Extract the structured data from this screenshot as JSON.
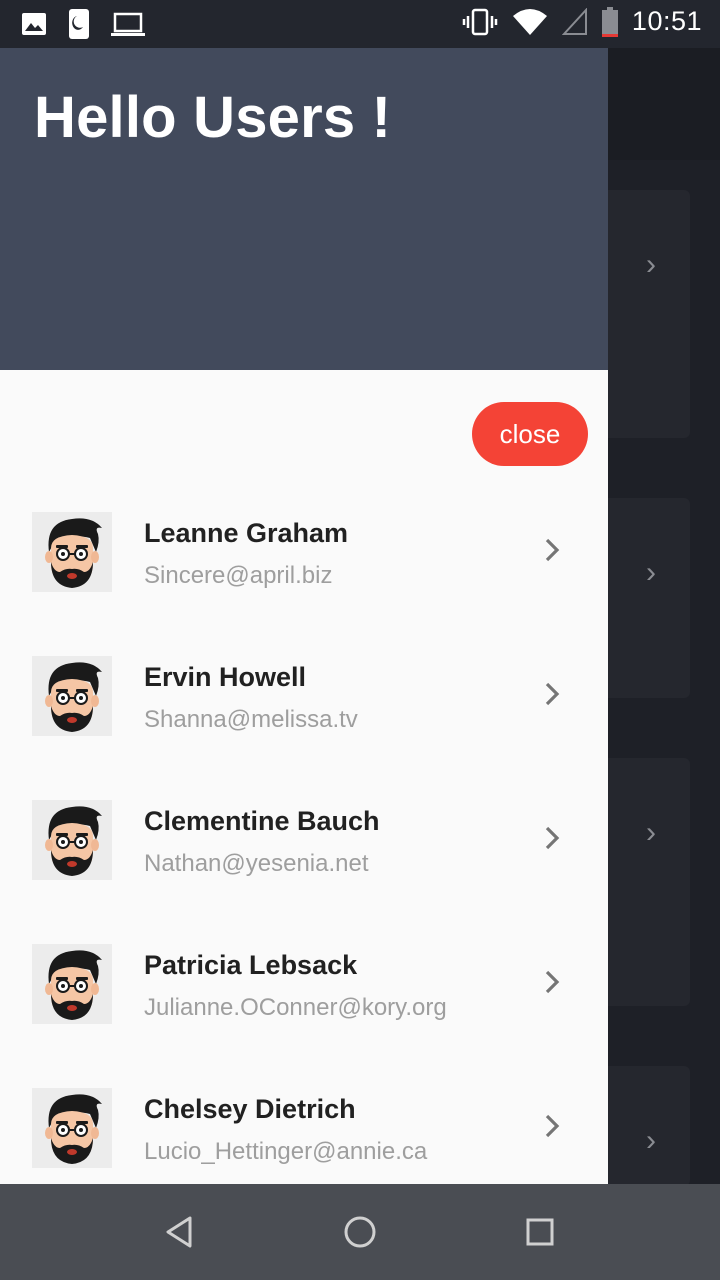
{
  "status_bar": {
    "time": "10:51",
    "left_icons": [
      "image-icon",
      "sim-card-icon",
      "laptop-icon"
    ],
    "right_icons": [
      "vibrate-icon",
      "wifi-icon",
      "signal-icon",
      "battery-icon"
    ]
  },
  "drawer": {
    "title": "Hello Users !",
    "close_label": "close",
    "users": [
      {
        "name": "Leanne Graham",
        "email": "Sincere@april.biz"
      },
      {
        "name": "Ervin Howell",
        "email": "Shanna@melissa.tv"
      },
      {
        "name": "Clementine Bauch",
        "email": "Nathan@yesenia.net"
      },
      {
        "name": "Patricia Lebsack",
        "email": "Julianne.OConner@kory.org"
      },
      {
        "name": "Chelsey Dietrich",
        "email": "Lucio_Hettinger@annie.ca"
      }
    ]
  },
  "nav_bar": {
    "buttons": [
      "back-icon",
      "home-icon",
      "recents-icon"
    ]
  },
  "colors": {
    "header": "#424a5c",
    "close_button": "#f44336",
    "drawer_bg": "#fafafa",
    "name_text": "#212121",
    "email_text": "#9e9e9e"
  }
}
